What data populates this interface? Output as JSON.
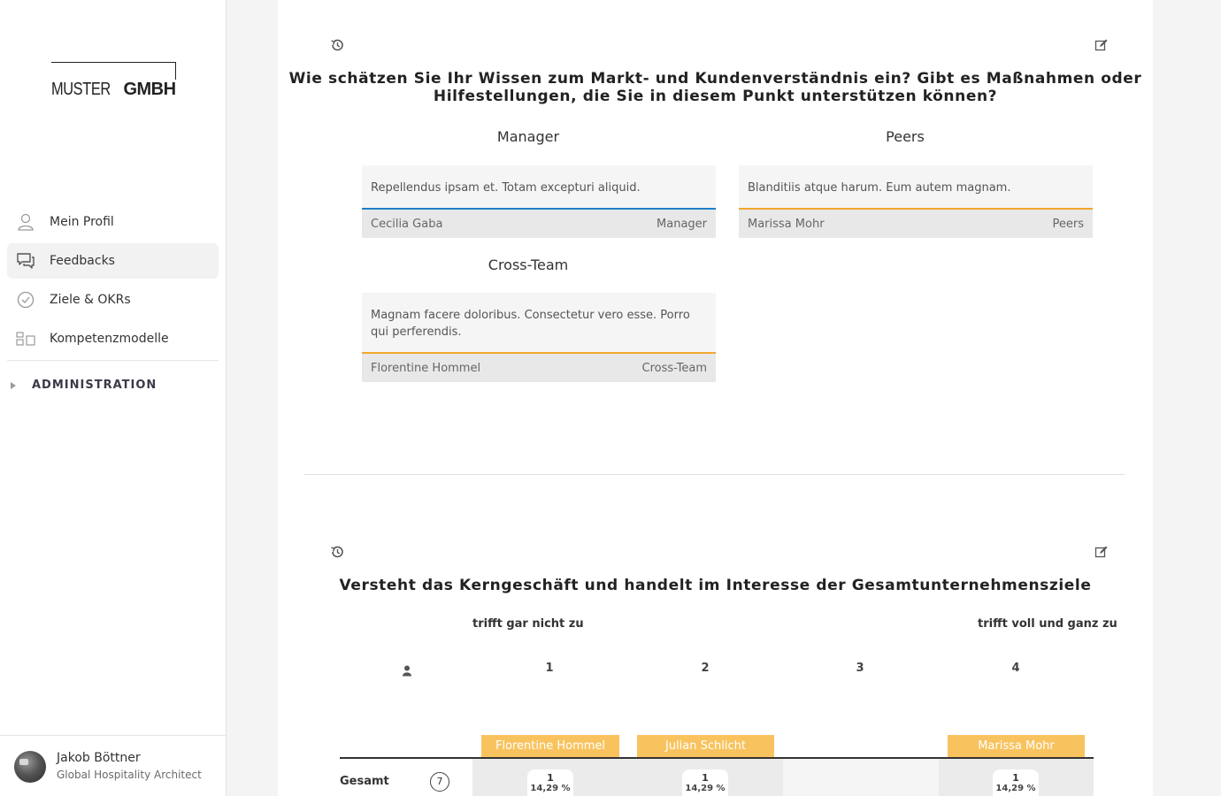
{
  "brand": {
    "logo_part1": "MUSTER",
    "logo_part2": "GMBH"
  },
  "sidebar": {
    "items": [
      {
        "label": "Mein Profil",
        "icon": "user-icon"
      },
      {
        "label": "Feedbacks",
        "icon": "chat-icon",
        "active": true
      },
      {
        "label": "Ziele & OKRs",
        "icon": "check-circle-icon"
      },
      {
        "label": "Kompetenzmodelle",
        "icon": "blocks-icon"
      }
    ],
    "admin_label": "ADMINISTRATION"
  },
  "user": {
    "name": "Jakob Böttner",
    "role": "Global Hospitality Architect"
  },
  "question1": {
    "title_line1": "Wie schätzen Sie Ihr Wissen zum Markt- und Kundenverständnis ein? Gibt es Maßnahmen oder",
    "title_line2": "Hilfestellungen, die Sie in diesem Punkt unterstützen können?",
    "groups": [
      {
        "title": "Manager",
        "text": "Repellendus ipsam et. Totam excepturi aliquid.",
        "author": "Cecilia Gaba",
        "tag": "Manager",
        "accent": "#1f7fc8"
      },
      {
        "title": "Peers",
        "text": "Blanditiis atque harum. Eum autem magnam.",
        "author": "Marissa Mohr",
        "tag": "Peers",
        "accent": "#f2a72e"
      },
      {
        "title": "Cross-Team",
        "text": "Magnam facere doloribus. Consectetur vero esse. Porro qui perferendis.",
        "author": "Florentine Hommel",
        "tag": "Cross-Team",
        "accent": "#f2a72e"
      }
    ]
  },
  "question2": {
    "title": "Versteht das Kerngeschäft und handelt im Interesse der Gesamtunternehmensziele",
    "scale_low": "trifft gar nicht zu",
    "scale_high": "trifft voll und ganz zu",
    "scale": [
      "1",
      "2",
      "3",
      "4"
    ],
    "tags": [
      "Florentine Hommel",
      "Julian Schlicht",
      "Marissa Mohr"
    ],
    "row_label": "Gesamt",
    "row_count": "7",
    "cells": [
      {
        "count": "1",
        "percent": "14,29 %"
      },
      {
        "count": "1",
        "percent": "14,29 %"
      },
      {
        "count": "1",
        "percent": "14,29 %"
      }
    ]
  },
  "colors": {
    "tag_yellow": "#f8c35f",
    "manager_blue": "#1f7fc8",
    "peer_orange": "#f2a72e"
  }
}
